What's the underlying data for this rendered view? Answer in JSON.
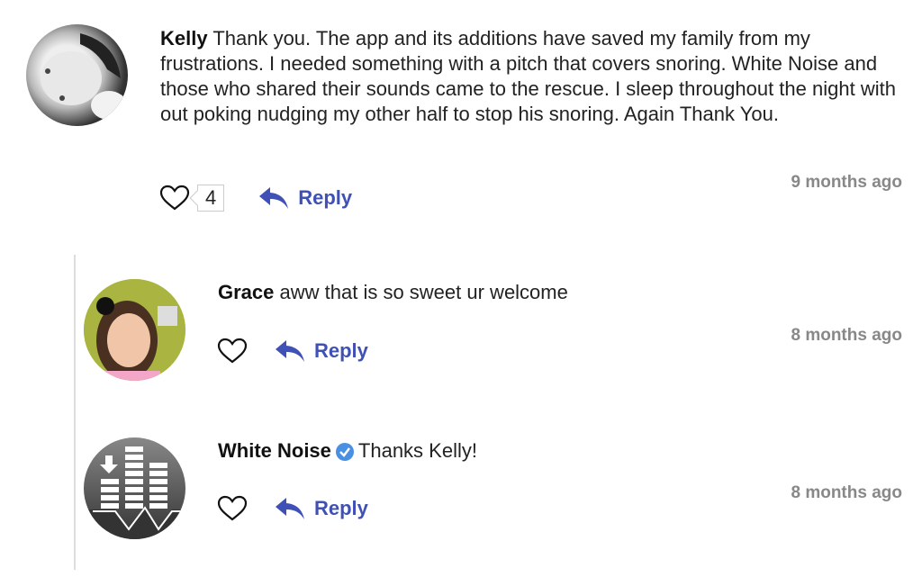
{
  "comments": [
    {
      "author": "Kelly",
      "text": "Thank you. The app and its additions have saved my family from my frustrations. I needed something with a pitch that covers snoring. White Noise and those who shared their sounds came to the rescue. I sleep throughout the night with out poking nudging my other half to stop his snoring. Again Thank You.",
      "likes": "4",
      "reply_label": "Reply",
      "time": "9 months ago",
      "verified": false
    }
  ],
  "replies": [
    {
      "author": "Grace",
      "text": "aww that is so sweet ur welcome",
      "reply_label": "Reply",
      "time": "8 months ago",
      "verified": false
    },
    {
      "author": "White Noise",
      "text": "Thanks Kelly!",
      "reply_label": "Reply",
      "time": "8 months ago",
      "verified": true
    }
  ],
  "colors": {
    "accent": "#3f51b5",
    "verified": "#4a90e2",
    "timestamp": "#888888"
  }
}
